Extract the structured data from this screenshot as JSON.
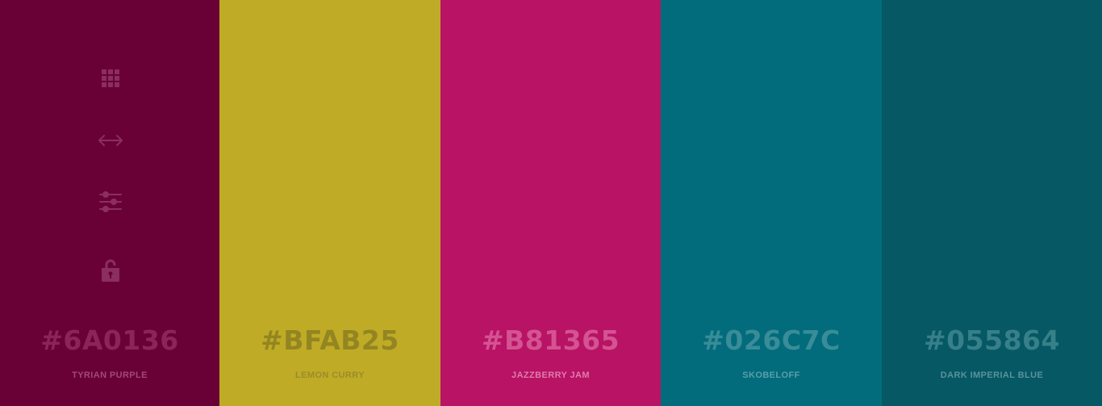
{
  "palette": {
    "swatches": [
      {
        "hex": "#6A0136",
        "name": "TYRIAN PURPLE",
        "bg": "#6A0136",
        "text_color": "#8f2a5c",
        "label_color": "#a04a75"
      },
      {
        "hex": "#BFAB25",
        "name": "LEMON CURRY",
        "bg": "#BFAB25",
        "text_color": "#8f8121",
        "label_color": "#9a8c2c"
      },
      {
        "hex": "#B81365",
        "name": "JAZZBERRY JAM",
        "bg": "#B81365",
        "text_color": "#d85a98",
        "label_color": "#e07cad"
      },
      {
        "hex": "#026C7C",
        "name": "SKOBELOFF",
        "bg": "#026C7C",
        "text_color": "#3f909c",
        "label_color": "#5a9fa9"
      },
      {
        "hex": "#055864",
        "name": "DARK IMPERIAL BLUE",
        "bg": "#055864",
        "text_color": "#3d848e",
        "label_color": "#5a939b"
      }
    ]
  },
  "toolbar": {
    "icon_color": "#8a2f5e",
    "icons": [
      "grid-icon",
      "swap-arrows-icon",
      "adjust-sliders-icon",
      "lock-icon"
    ]
  }
}
